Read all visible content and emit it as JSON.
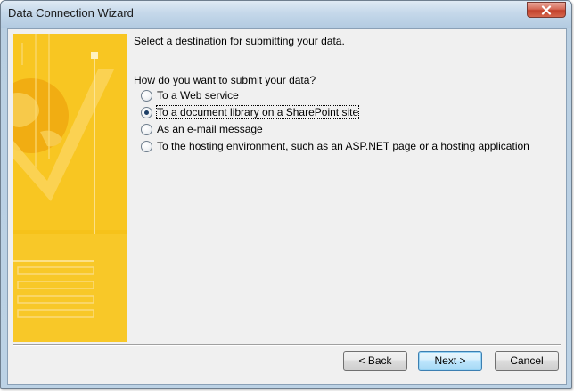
{
  "window": {
    "title": "Data Connection Wizard"
  },
  "content": {
    "heading": "Select a destination for submitting your data.",
    "question": "How do you want to submit your data?",
    "options": [
      {
        "label": "To a Web service",
        "checked": false
      },
      {
        "label": "To a document library on a SharePoint site",
        "checked": true
      },
      {
        "label": "As an e-mail message",
        "checked": false
      },
      {
        "label": "To the hosting environment, such as an ASP.NET page or a hosting application",
        "checked": false
      }
    ]
  },
  "buttons": {
    "back": "< Back",
    "next": "Next >",
    "cancel": "Cancel"
  },
  "colors": {
    "banner": "#f6c21a",
    "banner_light": "#fbd969",
    "accent_blue": "#3c7fb1"
  },
  "icons": {
    "close": "close-icon",
    "banner": "wizard-banner-graphic"
  }
}
